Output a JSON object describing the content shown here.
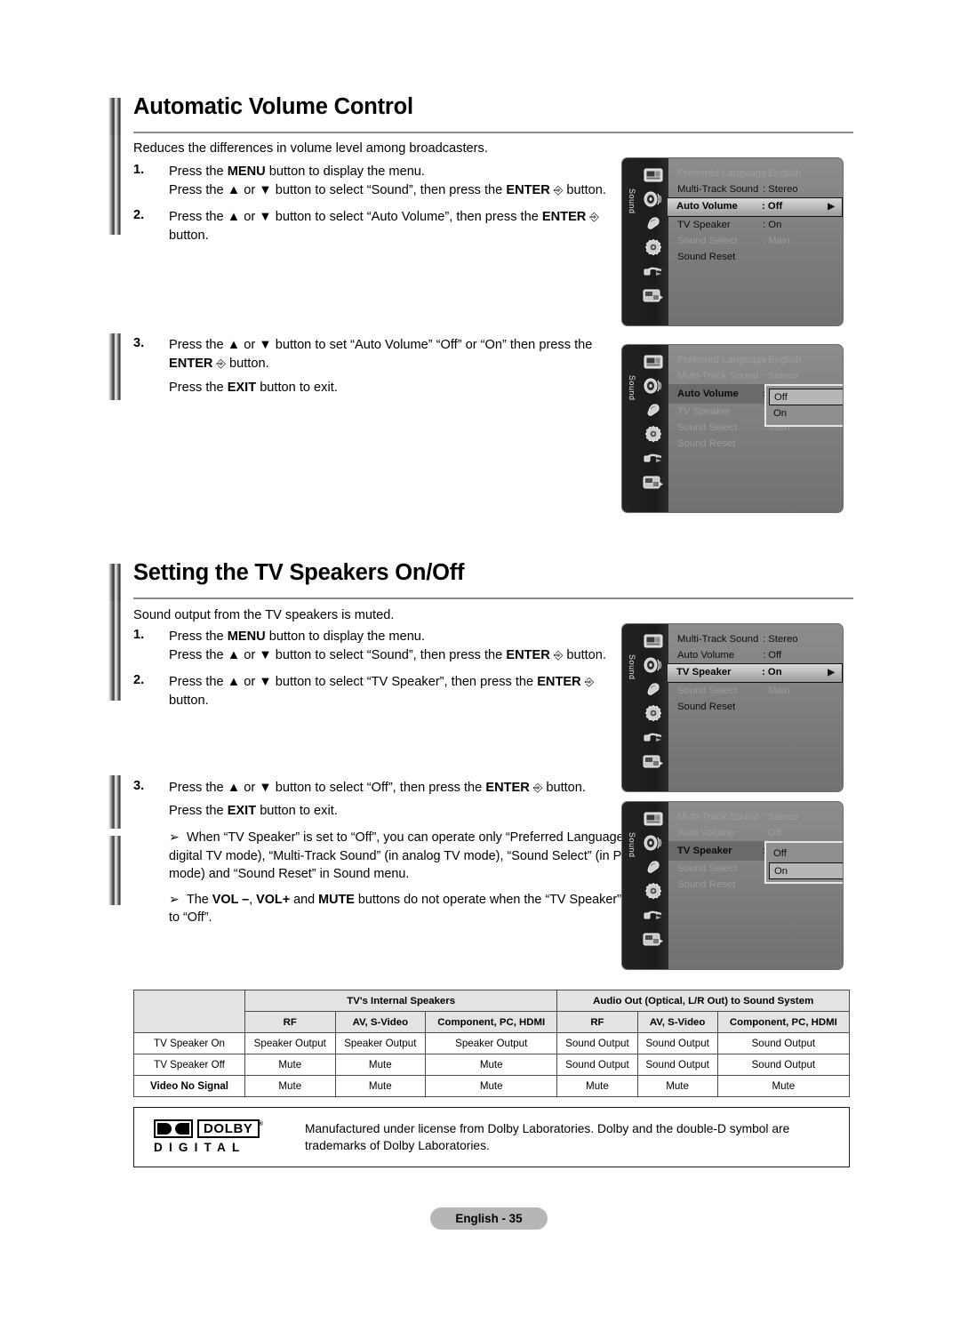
{
  "sections": [
    {
      "title": "Automatic Volume Control",
      "intro": "Reduces the differences in volume level among broadcasters.",
      "steps": [
        {
          "num": "1.",
          "lines": [
            "Press the MENU button to display the menu.",
            "Press the ▲ or ▼ button to select “Sound”, then press the ENTER ↲ button."
          ]
        },
        {
          "num": "2.",
          "lines": [
            "Press the ▲ or ▼ button to select “Auto Volume”, then press the ENTER ↲ button."
          ]
        },
        {
          "num": "3.",
          "lines": [
            "Press the ▲ or ▼ button to set “Auto Volume” “Off” or “On” then press the ENTER ↲ button.",
            "Press the EXIT button to exit."
          ]
        }
      ]
    },
    {
      "title": "Setting the TV Speakers On/Off",
      "intro": "Sound output from the TV speakers is muted.",
      "steps": [
        {
          "num": "1.",
          "lines": [
            "Press the MENU button to display the menu.",
            "Press the ▲ or ▼ button to select “Sound”, then press the ENTER ↲ button."
          ]
        },
        {
          "num": "2.",
          "lines": [
            "Press the ▲ or ▼ button to select “TV Speaker”, then press the ENTER ↲ button."
          ]
        },
        {
          "num": "3.",
          "lines": [
            "Press the ▲ or ▼ button to select “Off”, then press the ENTER ↲ button.",
            "Press the EXIT button to exit."
          ]
        }
      ],
      "notes": [
        "When “TV Speaker” is set to “Off”, you can operate only “Preferred Language” (in digital TV mode), “Multi-Track Sound” (in analog TV mode), “Sound Select” (in PIP mode) and “Sound Reset” in Sound menu.",
        "The VOL –, VOL+ and MUTE buttons do not operate when the “TV Speaker” is set to “Off”."
      ],
      "note_bullet": "➢"
    }
  ],
  "osd": {
    "rail_label": "Sound",
    "icons": [
      "picture-icon",
      "sound-icon",
      "channel-icon",
      "setup-icon",
      "input-icon",
      "pip-icon"
    ],
    "menus": [
      {
        "id": "osd-auto-volume-highlight",
        "rows": [
          {
            "label": "Preferred Language",
            "value": ": English",
            "state": "dim"
          },
          {
            "label": "Multi-Track Sound",
            "value": ": Stereo",
            "state": "bright"
          },
          {
            "label": "Auto Volume",
            "value": ": Off",
            "state": "selected",
            "arrow": "▶"
          },
          {
            "label": "TV Speaker",
            "value": ": On",
            "state": "bright"
          },
          {
            "label": "Sound Select",
            "value": ": Main",
            "state": "dim"
          },
          {
            "label": "Sound Reset",
            "value": "",
            "state": "bright"
          }
        ],
        "popup": null
      },
      {
        "id": "osd-auto-volume-popup",
        "rows": [
          {
            "label": "Preferred Language",
            "value": ": English",
            "state": "dim"
          },
          {
            "label": "Multi-Track Sound",
            "value": ": Stereo",
            "state": "dim"
          },
          {
            "label": "Auto Volume",
            "value": ":",
            "state": "selflat"
          },
          {
            "label": "TV Speaker",
            "value": ":",
            "state": "dim"
          },
          {
            "label": "Sound Select",
            "value": ": Main",
            "state": "dim"
          },
          {
            "label": "Sound Reset",
            "value": "",
            "state": "dim"
          }
        ],
        "popup": {
          "options": [
            "Off",
            "On"
          ],
          "selected": "Off"
        }
      },
      {
        "id": "osd-tv-speaker-highlight",
        "rows": [
          {
            "label": "Multi-Track Sound",
            "value": ": Stereo",
            "state": "bright"
          },
          {
            "label": "Auto Volume",
            "value": ": Off",
            "state": "bright"
          },
          {
            "label": "TV Speaker",
            "value": ": On",
            "state": "selected",
            "arrow": "▶"
          },
          {
            "label": "Sound Select",
            "value": ": Main",
            "state": "dim"
          },
          {
            "label": "Sound Reset",
            "value": "",
            "state": "bright"
          }
        ],
        "popup": null
      },
      {
        "id": "osd-tv-speaker-popup",
        "rows": [
          {
            "label": "Multi-Track Sound",
            "value": ": Stereo",
            "state": "dim"
          },
          {
            "label": "Auto Volume",
            "value": ": Off",
            "state": "dim"
          },
          {
            "label": "TV Speaker",
            "value": ":",
            "state": "selflat"
          },
          {
            "label": "Sound Select",
            "value": ":",
            "state": "dim"
          },
          {
            "label": "Sound Reset",
            "value": "",
            "state": "dim"
          }
        ],
        "popup": {
          "options": [
            "Off",
            "On"
          ],
          "selected": "On"
        }
      }
    ]
  },
  "table": {
    "group_headers": [
      "",
      "TV's Internal Speakers",
      "Audio Out (Optical, L/R Out) to Sound System"
    ],
    "sub_headers": [
      "RF",
      "AV, S-Video",
      "Component, PC, HDMI",
      "RF",
      "AV, S-Video",
      "Component, PC, HDMI"
    ],
    "rows": [
      {
        "label": "TV Speaker On",
        "bold": false,
        "cells": [
          "Speaker Output",
          "Speaker Output",
          "Speaker Output",
          "Sound Output",
          "Sound Output",
          "Sound Output"
        ]
      },
      {
        "label": "TV Speaker Off",
        "bold": false,
        "cells": [
          "Mute",
          "Mute",
          "Mute",
          "Sound Output",
          "Sound Output",
          "Sound Output"
        ]
      },
      {
        "label": "Video No Signal",
        "bold": true,
        "cells": [
          "Mute",
          "Mute",
          "Mute",
          "Mute",
          "Mute",
          "Mute"
        ]
      }
    ]
  },
  "dolby": {
    "word": "DOLBY",
    "reg": "®",
    "sub": "DIGITAL",
    "text": "Manufactured under license from Dolby Laboratories. Dolby and the double-D symbol are trademarks of Dolby Laboratories."
  },
  "footer": {
    "page_label": "English - 35"
  }
}
